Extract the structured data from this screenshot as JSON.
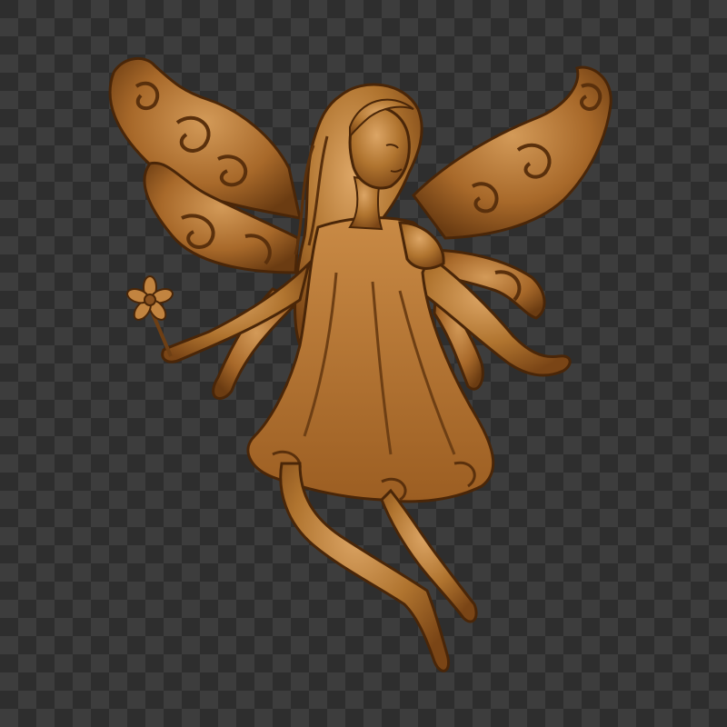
{
  "image": {
    "subject": "carved-wood-fairy-relief",
    "background": "transparency-checkerboard",
    "colors": {
      "checker_dark": "#2e2e2e",
      "checker_light": "#3d3d3d",
      "wood_base": "#b0742f",
      "wood_light": "#d8a060",
      "wood_shadow": "#6e3f14",
      "wood_deep": "#4a2608"
    }
  }
}
